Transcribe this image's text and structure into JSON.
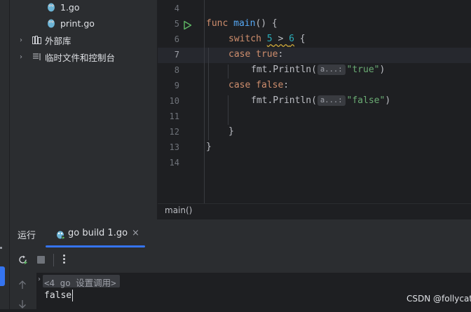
{
  "tree": {
    "items": [
      {
        "label": "1.go",
        "icon": "go-file-icon"
      },
      {
        "label": "print.go",
        "icon": "go-file-icon"
      },
      {
        "label": "外部库",
        "icon": "library-icon"
      },
      {
        "label": "临时文件和控制台",
        "icon": "scratch-icon"
      }
    ]
  },
  "editor": {
    "line_numbers": [
      "4",
      "5",
      "6",
      "7",
      "8",
      "9",
      "10",
      "11",
      "12",
      "13",
      "14"
    ],
    "current_line": "7",
    "code": {
      "l5_kw": "func",
      "l5_fn": "main",
      "l5_rest": "() {",
      "l6_kw": "switch",
      "l6_a": "5",
      "l6_op": " > ",
      "l6_b": "6",
      "l6_rest": " {",
      "l7_kw": "case",
      "l7_val": "true",
      "l7_rest": ":",
      "l8_call": "fmt.Println(",
      "l8_hint": "a...:",
      "l8_str": "\"true\"",
      "l8_rest": ")",
      "l9_kw": "case",
      "l9_val": "false",
      "l9_rest": ":",
      "l10_call": "fmt.Println(",
      "l10_hint": "a...:",
      "l10_str": "\"false\"",
      "l10_rest": ")",
      "l12": "}",
      "l13": "}"
    },
    "breadcrumb": "main()"
  },
  "run_panel": {
    "title": "运行",
    "tab_label": "go build 1.go",
    "tab_close": "×",
    "fold_text": "<4 go 设置调用>",
    "output": "false"
  },
  "watermark": "CSDN @follycat",
  "colors": {
    "accent": "#3574f0",
    "keyword": "#cf8e6d",
    "function": "#56a8f5",
    "number": "#2aacb8",
    "string": "#6aab73",
    "run_green": "#5fb865"
  }
}
